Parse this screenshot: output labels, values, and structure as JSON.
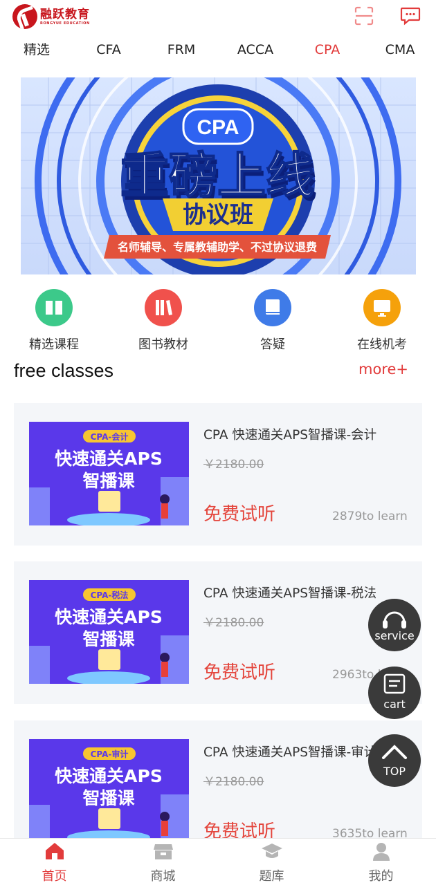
{
  "header": {
    "logo_cn": "融跃教育",
    "logo_en": "RONGYUE EDUCATION",
    "scan_icon": "scan-icon",
    "message_icon": "message-icon"
  },
  "tabs": [
    {
      "label": "精选",
      "active": false
    },
    {
      "label": "CFA",
      "active": false
    },
    {
      "label": "FRM",
      "active": false
    },
    {
      "label": "ACCA",
      "active": false
    },
    {
      "label": "CPA",
      "active": true
    },
    {
      "label": "CMA",
      "active": false
    }
  ],
  "banner": {
    "badge": "CPA",
    "headline": "重磅上线",
    "subheadline": "协议班",
    "ribbon": "名师辅导、专属教辅助学、不过协议退费"
  },
  "quicknav": [
    {
      "label": "精选课程",
      "icon": "book-open-icon",
      "color": "#3cc98a"
    },
    {
      "label": "图书教材",
      "icon": "books-icon",
      "color": "#f0514c"
    },
    {
      "label": "答疑",
      "icon": "book-icon",
      "color": "#3f7be8"
    },
    {
      "label": "在线机考",
      "icon": "monitor-icon",
      "color": "#f5a10b"
    }
  ],
  "section": {
    "title": "free classes",
    "more": "more+"
  },
  "courses": [
    {
      "tag": "CPA-会计",
      "thumb_line1": "快速通关APS",
      "thumb_line2": "智播课",
      "title": "CPA 快速通关APS智播课-会计",
      "price": "￥2180.00",
      "free": "免费试听",
      "count": "2879to learn"
    },
    {
      "tag": "CPA-税法",
      "thumb_line1": "快速通关APS",
      "thumb_line2": "智播课",
      "title": "CPA 快速通关APS智播课-税法",
      "price": "￥2180.00",
      "free": "免费试听",
      "count": "2963to learn"
    },
    {
      "tag": "CPA-审计",
      "thumb_line1": "快速通关APS",
      "thumb_line2": "智播课",
      "title": "CPA 快速通关APS智播课-审计",
      "price": "￥2180.00",
      "free": "免费试听",
      "count": "3635to learn"
    }
  ],
  "fabs": {
    "service": "service",
    "cart": "cart",
    "top": "TOP"
  },
  "bottomnav": [
    {
      "label": "首页",
      "icon": "home-icon",
      "active": true
    },
    {
      "label": "商城",
      "icon": "shop-icon",
      "active": false
    },
    {
      "label": "题库",
      "icon": "graduation-cap-icon",
      "active": false
    },
    {
      "label": "我的",
      "icon": "user-icon",
      "active": false
    }
  ],
  "colors": {
    "accent": "#e23b3b",
    "fab": "#3a3a3a",
    "card_bg": "#f4f6f9"
  }
}
